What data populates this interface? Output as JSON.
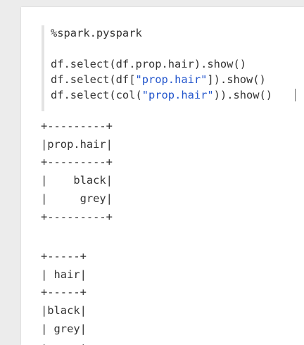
{
  "notebook": {
    "paragraph": {
      "code_lines": [
        {
          "text": "%spark.pyspark"
        },
        {
          "text": ""
        },
        {
          "text": "df.select(df.prop.hair).show()"
        },
        {
          "pre": "df.select(df[",
          "str": "\"prop.hair\"",
          "post": "]).show()"
        },
        {
          "pre": "df.select(col(",
          "str": "\"prop.hair\"",
          "post": ")).show()"
        }
      ],
      "output_lines": [
        "+---------+",
        "|prop.hair|",
        "+---------+",
        "|    black|",
        "|     grey|",
        "+---------+",
        "",
        "",
        "+-----+",
        "| hair|",
        "+-----+",
        "|black|",
        "| grey|",
        "+-----+"
      ]
    }
  },
  "colors": {
    "string_literal": "#2255cc",
    "text": "#333333",
    "background": "#ececec",
    "card": "#ffffff"
  }
}
